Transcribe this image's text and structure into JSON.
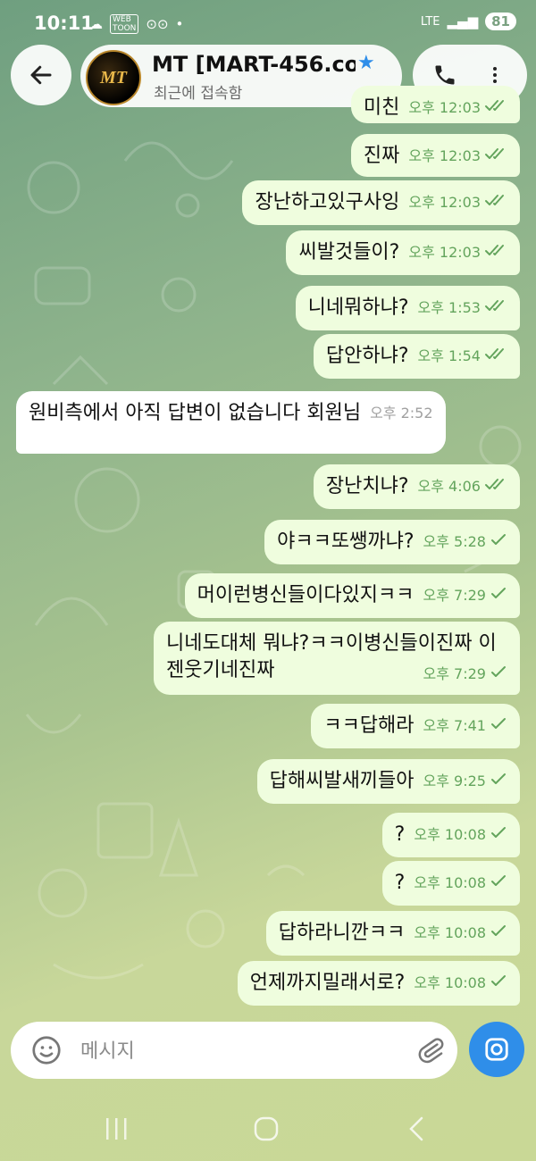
{
  "status_bar": {
    "time": "10:11",
    "notification_icons": [
      "cloud-icon",
      "webtoon-icon",
      "voicemail-icon",
      "dot-icon"
    ],
    "network": "LTE",
    "battery": "81"
  },
  "header": {
    "back_icon": "arrow-left-icon",
    "avatar_text": "MT",
    "chat_name": "MT [MART-456.co",
    "verified_icon": "star-icon",
    "status": "최근에 접속함",
    "call_icon": "phone-icon",
    "menu_icon": "more-vertical-icon"
  },
  "colors": {
    "accent": "#2f8ee9",
    "outgoing_bubble": "#effdde",
    "incoming_bubble": "#ffffff",
    "check": "#63a45c"
  },
  "messages": [
    {
      "dir": "out",
      "text": "미친",
      "time": "오후 12:03",
      "read": true
    },
    {
      "dir": "out",
      "text": "진짜",
      "time": "오후 12:03",
      "read": true
    },
    {
      "dir": "out",
      "text": "장난하고있구사잉",
      "time": "오후 12:03",
      "read": true
    },
    {
      "dir": "out",
      "text": "씨발것들이?",
      "time": "오후 12:03",
      "read": true
    },
    {
      "dir": "out",
      "text": "니네뭐하냐?",
      "time": "오후 1:53",
      "read": true
    },
    {
      "dir": "out",
      "text": "답안하냐?",
      "time": "오후 1:54",
      "read": true
    },
    {
      "dir": "in",
      "text": "원비측에서 아직 답변이 없습니다 회원님",
      "time": "오후 2:52"
    },
    {
      "dir": "out",
      "text": "장난치냐?",
      "time": "오후 4:06",
      "read": true
    },
    {
      "dir": "out",
      "text": "야ㅋㅋ또쌩까냐?",
      "time": "오후 5:28",
      "read": false
    },
    {
      "dir": "out",
      "text": "머이런병신들이다있지ㅋㅋ",
      "time": "오후 7:29",
      "read": false
    },
    {
      "dir": "out",
      "text": "니네도대체 뭐냐?ㅋㅋ이병신들이진짜 이젠웃기네진짜",
      "time": "오후 7:29",
      "read": false
    },
    {
      "dir": "out",
      "text": "ㅋㅋ답해라",
      "time": "오후 7:41",
      "read": false
    },
    {
      "dir": "out",
      "text": "답해씨발새끼들아",
      "time": "오후 9:25",
      "read": false
    },
    {
      "dir": "out",
      "text": "?",
      "time": "오후 10:08",
      "read": false
    },
    {
      "dir": "out",
      "text": "?",
      "time": "오후 10:08",
      "read": false
    },
    {
      "dir": "out",
      "text": "답하라니깐ㅋㅋ",
      "time": "오후 10:08",
      "read": false
    },
    {
      "dir": "out",
      "text": "언제까지밀래서로?",
      "time": "오후 10:08",
      "read": false
    }
  ],
  "input": {
    "placeholder": "메시지",
    "emoji_icon": "smiley-icon",
    "attach_icon": "paperclip-icon",
    "camera_icon": "camera-icon"
  },
  "nav_bar": {
    "items": [
      "recent-apps-icon",
      "home-icon",
      "back-icon"
    ]
  }
}
